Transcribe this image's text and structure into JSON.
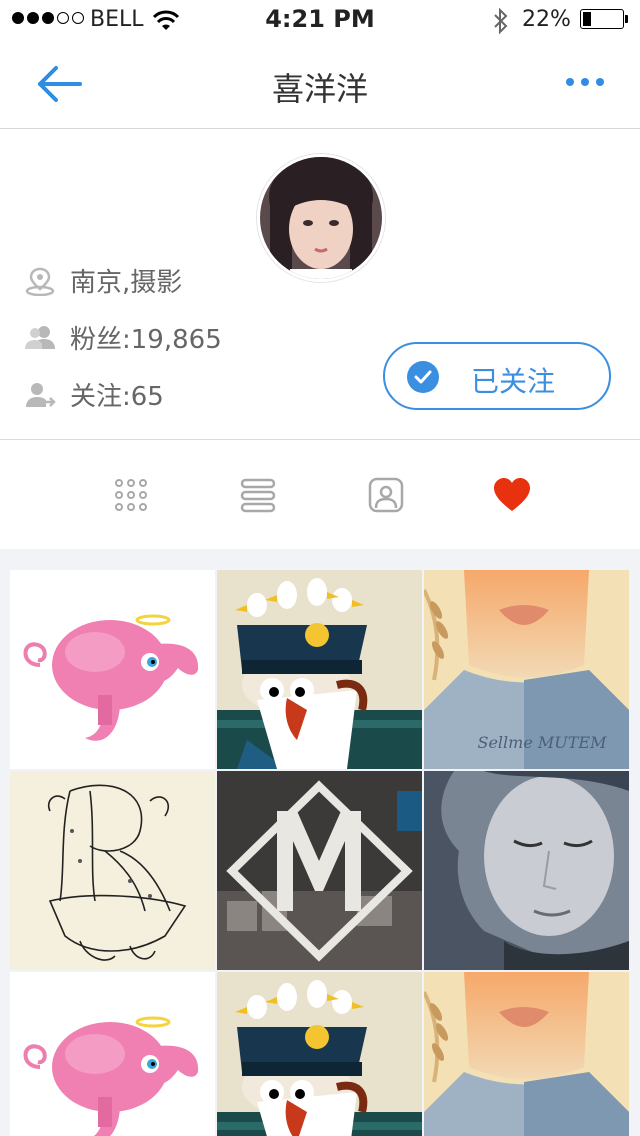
{
  "status_bar": {
    "carrier": "BELL",
    "time": "4:21 PM",
    "battery": "22%",
    "battery_level": 0.22,
    "signal_bars_filled": 3,
    "signal_bars_total": 5
  },
  "nav": {
    "title": "喜洋洋",
    "back_icon": "arrow-left-icon",
    "more_icon": "more-dots-icon"
  },
  "profile": {
    "location": "南京,摄影",
    "fans": "粉丝:19,865",
    "following": "关注:65",
    "follow_button": "已关注"
  },
  "tabs": [
    {
      "icon": "grid-icon",
      "active": false
    },
    {
      "icon": "list-icon",
      "active": false
    },
    {
      "icon": "portrait-icon",
      "active": false
    },
    {
      "icon": "heart-icon",
      "active": true
    }
  ],
  "gallery": [
    {
      "name": "pink-elephant-illustration",
      "caption": ""
    },
    {
      "name": "sailor-captain-illustration",
      "caption": ""
    },
    {
      "name": "girl-portrait-illustration",
      "caption": "Sellme MUTEM"
    },
    {
      "name": "tree-letter-r-illustration",
      "caption": ""
    },
    {
      "name": "letter-m-harbor-photo",
      "caption": ""
    },
    {
      "name": "woman-face-monochrome",
      "caption": ""
    },
    {
      "name": "pink-elephant-illustration",
      "caption": ""
    },
    {
      "name": "sailor-captain-illustration",
      "caption": ""
    },
    {
      "name": "girl-portrait-illustration",
      "caption": ""
    }
  ],
  "colors": {
    "accent": "#3b8fe0",
    "heart": "#e8310e",
    "icon_gray": "#a8a8a8",
    "grid_background": "#f2f3f6"
  }
}
